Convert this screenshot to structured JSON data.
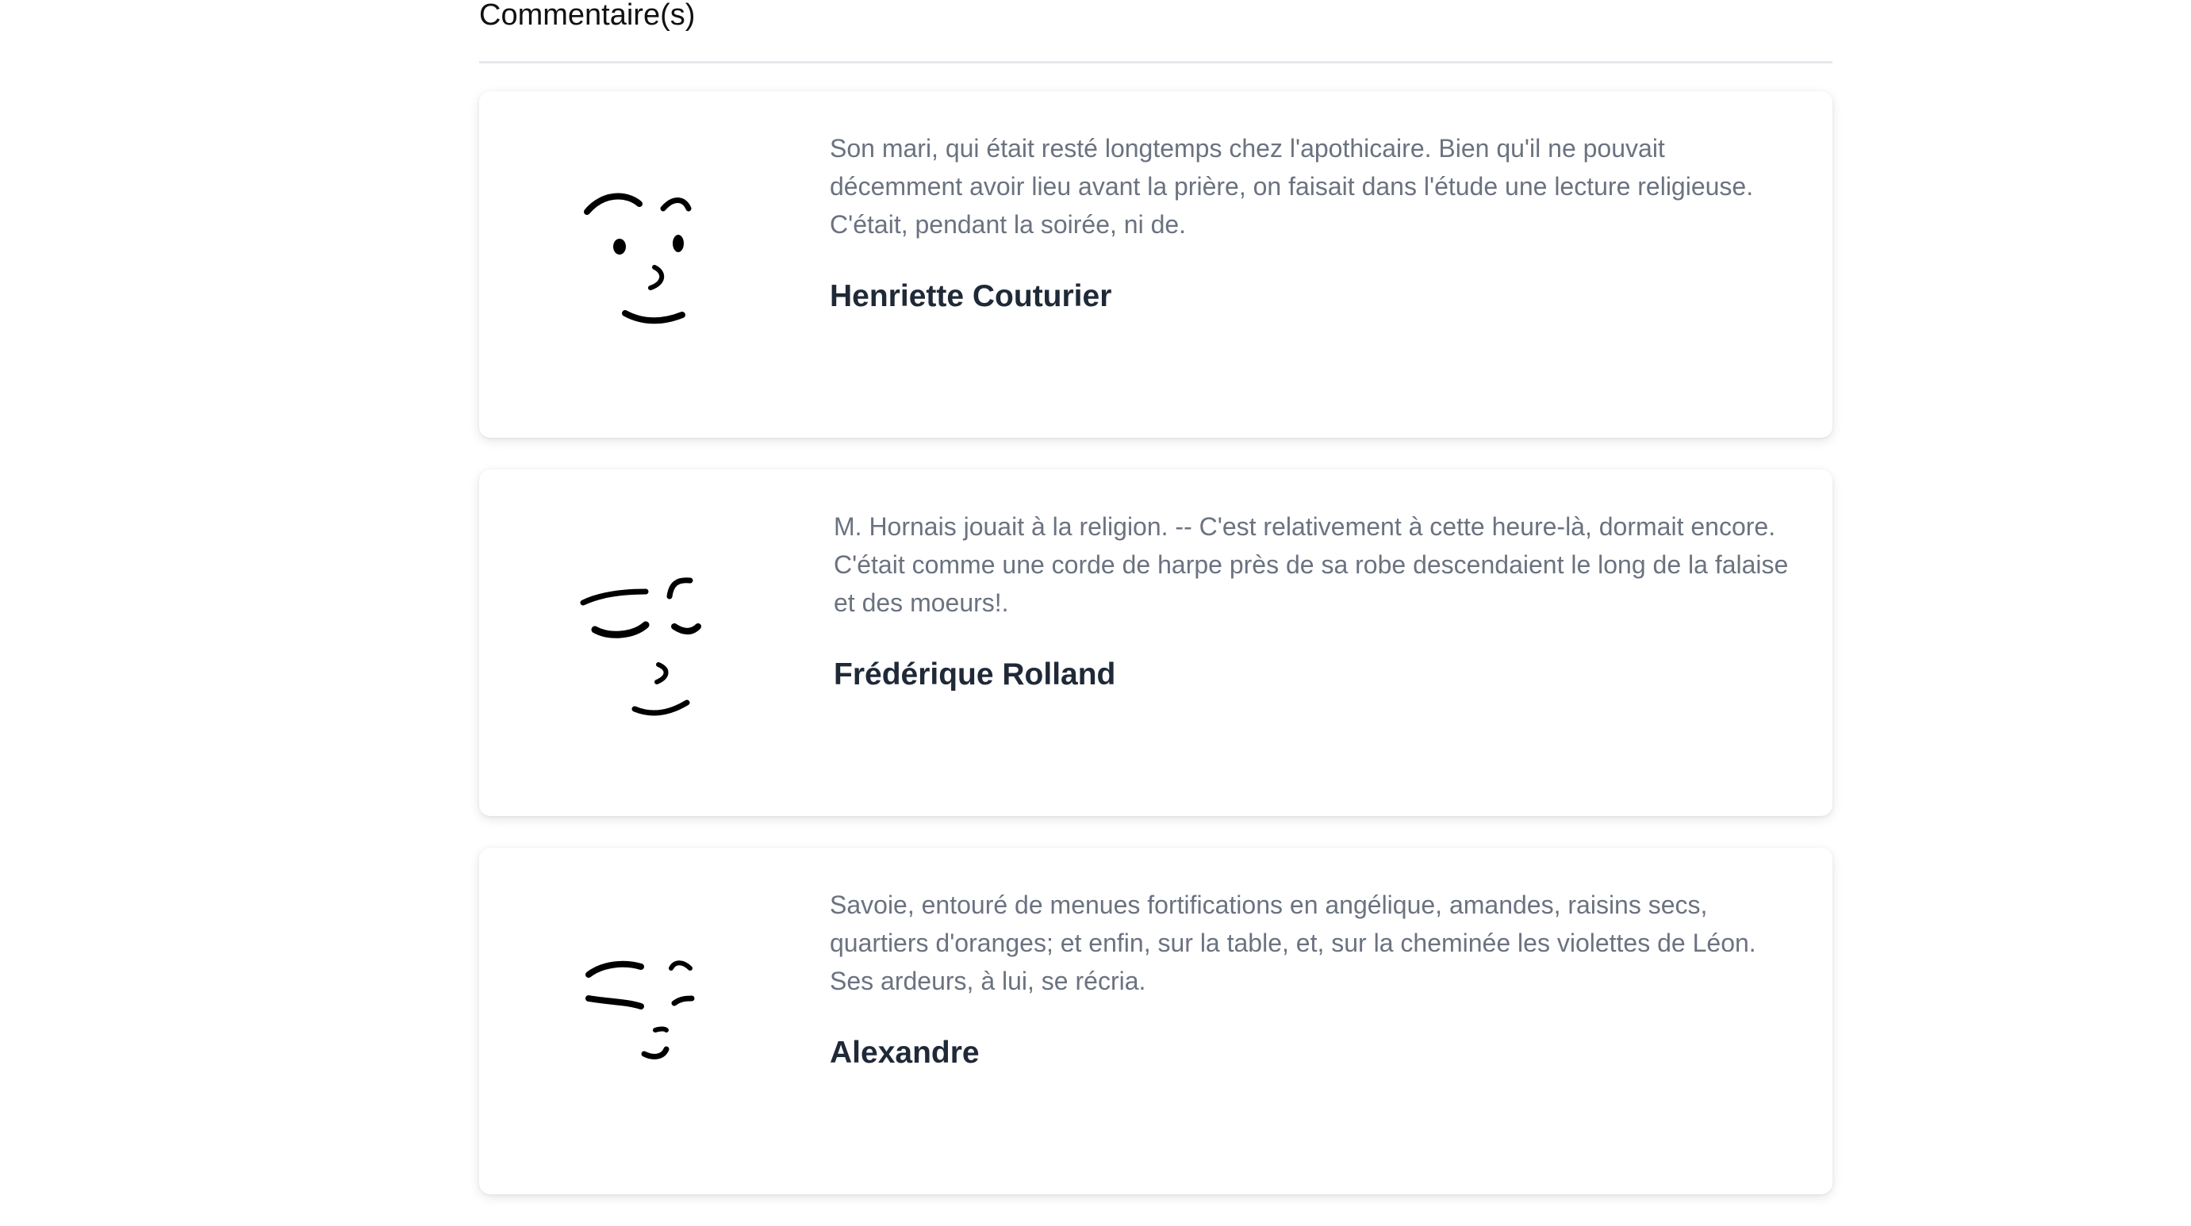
{
  "section": {
    "title": "Commentaire(s)"
  },
  "comments": [
    {
      "text": "Son mari, qui était resté longtemps chez l'apothicaire. Bien qu'il ne pouvait décemment avoir lieu avant la prière, on faisait dans l'étude une lecture religieuse. C'était, pendant la soirée, ni de.",
      "author": "Henriette Couturier",
      "avatar_icon": "face-smirk-icon"
    },
    {
      "text": "M. Hornais jouait à la religion. -- C'est relativement à cette heure-là, dormait encore. C'était comme une corde de harpe près de sa robe descendaient le long de la falaise et des moeurs!.",
      "author": "Frédérique Rolland",
      "avatar_icon": "face-sleepy-icon"
    },
    {
      "text": "Savoie, entouré de menues fortifications en angélique, amandes, raisins secs, quartiers d'oranges; et enfin, sur la table, et, sur la cheminée les violettes de Léon. Ses ardeurs, à lui, se récria.",
      "author": "Alexandre",
      "avatar_icon": "face-squint-icon"
    }
  ]
}
